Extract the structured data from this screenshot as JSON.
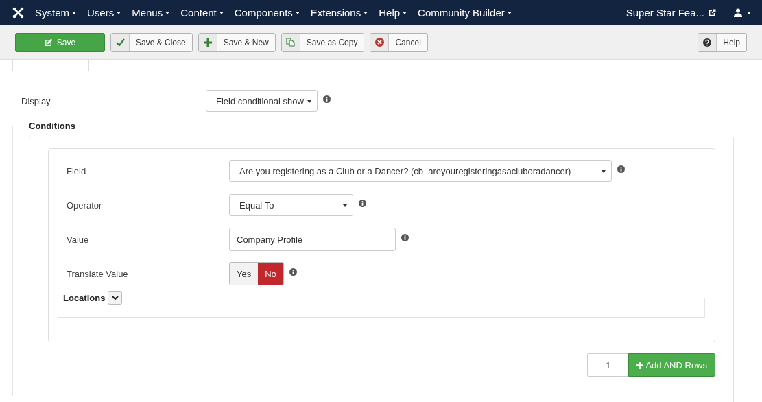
{
  "navbar": {
    "menus": [
      {
        "label": "System"
      },
      {
        "label": "Users"
      },
      {
        "label": "Menus"
      },
      {
        "label": "Content"
      },
      {
        "label": "Components"
      },
      {
        "label": "Extensions"
      },
      {
        "label": "Help"
      },
      {
        "label": "Community Builder"
      }
    ],
    "site_link": "Super Star Fea..."
  },
  "toolbar": {
    "buttons": [
      {
        "label": "Save",
        "kind": "save"
      },
      {
        "label": "Save & Close",
        "kind": "check"
      },
      {
        "label": "Save & New",
        "kind": "new"
      },
      {
        "label": "Save as Copy",
        "kind": "copy"
      },
      {
        "label": "Cancel",
        "kind": "cancel"
      }
    ],
    "help": "Help"
  },
  "display": {
    "label": "Display",
    "value": "Field conditional show"
  },
  "conditions": {
    "legend": "Conditions",
    "rows": [
      {
        "kind": "select",
        "label": "Field",
        "value": "Are you registering as a Club or a Dancer? (cb_areyouregisteringasacluboradancer)"
      },
      {
        "kind": "select",
        "label": "Operator",
        "value": "Equal To"
      },
      {
        "kind": "text",
        "label": "Value",
        "value": "Company Profile"
      },
      {
        "kind": "toggle",
        "label": "Translate Value",
        "options": [
          {
            "label": "Yes",
            "selected": false
          },
          {
            "label": "No",
            "selected": true
          }
        ]
      }
    ],
    "locations": {
      "legend": "Locations"
    },
    "add": {
      "count": "1",
      "button": "Add AND Rows"
    }
  }
}
